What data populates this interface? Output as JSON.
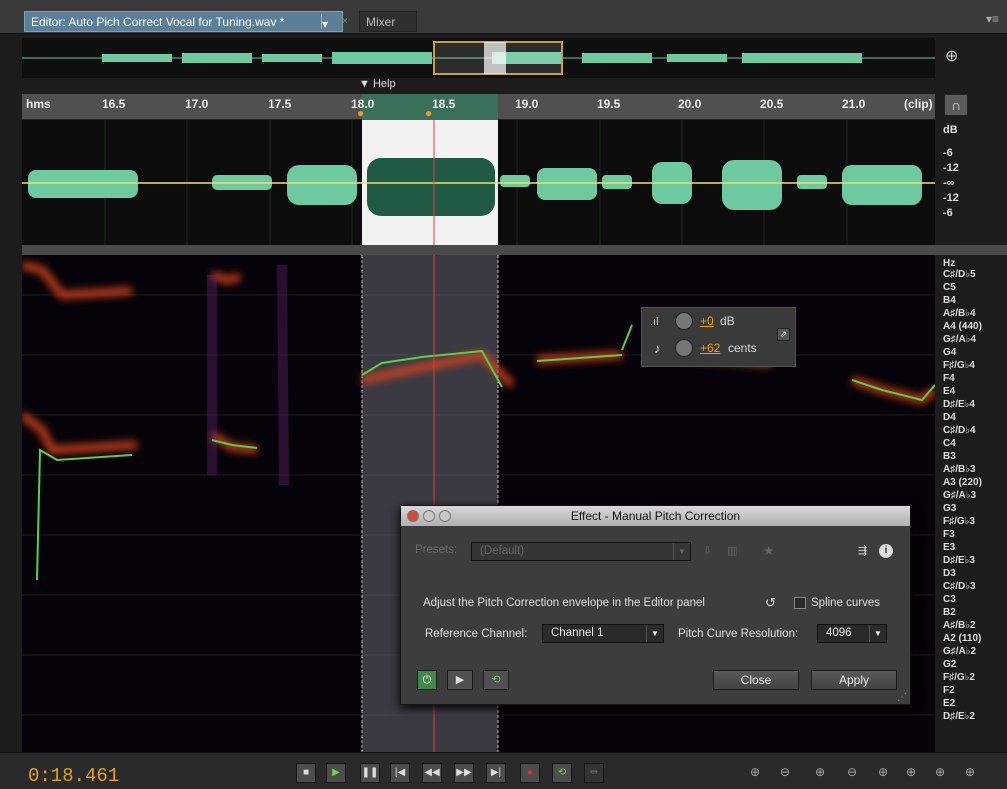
{
  "tabs": {
    "editor": "Editor: Auto Pich Correct Vocal for Tuning.wav *",
    "mixer": "Mixer",
    "close": "×",
    "menu": "▾≡"
  },
  "overview_zoom": "⊕",
  "help_marker": "Help",
  "ruler": {
    "unit": "hms",
    "clip": "(clip)",
    "labels": [
      "16.5",
      "17.0",
      "17.5",
      "18.0",
      "18.5",
      "19.0",
      "19.5",
      "20.0",
      "20.5",
      "21.0"
    ],
    "headphone": "∩"
  },
  "db_scale": [
    "dB",
    "-6",
    "-12",
    "-∞",
    "-12",
    "-6"
  ],
  "hz_scale": [
    "Hz",
    "C♯/D♭5",
    "C5",
    "B4",
    "A♯/B♭4",
    "A4 (440)",
    "G♯/A♭4",
    "G4",
    "F♯/G♭4",
    "F4",
    "E4",
    "D♯/E♭4",
    "D4",
    "C♯/D♭4",
    "C4",
    "B3",
    "A♯/B♭3",
    "A3 (220)",
    "G♯/A♭3",
    "G3",
    "F♯/G♭3",
    "F3",
    "E3",
    "D♯/E♭3",
    "D3",
    "C♯/D♭3",
    "C3",
    "B2",
    "A♯/B♭2",
    "A2 (110)",
    "G♯/A♭2",
    "G2",
    "F♯/G♭2",
    "F2",
    "E2",
    "D♯/E♭2"
  ],
  "hud": {
    "volume_value": "+0",
    "volume_unit": "dB",
    "pitch_value": "+62",
    "pitch_unit": "cents"
  },
  "dialog": {
    "title": "Effect - Manual Pitch Correction",
    "presets_label": "Presets:",
    "preset_value": "(Default)",
    "instruction": "Adjust the Pitch Correction envelope in the Editor panel",
    "spline_label": "Spline curves",
    "ref_label": "Reference Channel:",
    "ref_value": "Channel 1",
    "res_label": "Pitch Curve Resolution:",
    "res_value": "4096",
    "close": "Close",
    "apply": "Apply"
  },
  "transport": {
    "timecode": "0:18.461"
  },
  "colors": {
    "accent": "#e5a020",
    "waveform": "#6cc9a0",
    "selection": "#3a6f59",
    "pitch_curve": "#54d24a",
    "tab_active": "#5b7e99"
  }
}
